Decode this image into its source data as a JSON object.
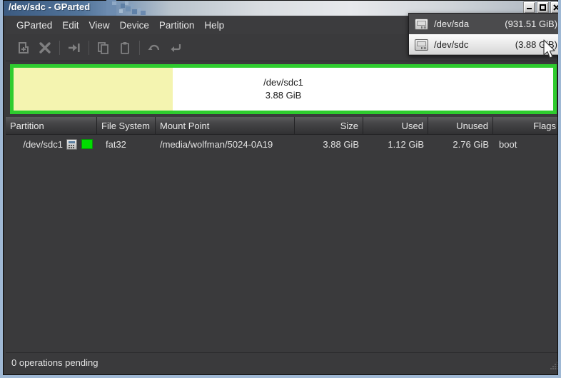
{
  "window": {
    "title": "/dev/sdc - GParted",
    "controls": [
      {
        "name": "minimize",
        "glyph": "–"
      },
      {
        "name": "maximize",
        "glyph": "□"
      },
      {
        "name": "close",
        "glyph": "✕"
      }
    ]
  },
  "menubar": {
    "items": [
      {
        "label": "GParted"
      },
      {
        "label": "Edit"
      },
      {
        "label": "View"
      },
      {
        "label": "Device"
      },
      {
        "label": "Partition"
      },
      {
        "label": "Help"
      }
    ]
  },
  "toolbar": {
    "buttons": [
      {
        "name": "new-partition-icon",
        "label": "New"
      },
      {
        "name": "delete-partition-icon",
        "label": "Delete"
      },
      {
        "name": "resize-move-icon",
        "label": "Resize/Move"
      },
      {
        "name": "copy-icon",
        "label": "Copy"
      },
      {
        "name": "paste-icon",
        "label": "Paste"
      },
      {
        "name": "undo-icon",
        "label": "Undo"
      },
      {
        "name": "apply-icon",
        "label": "Apply"
      }
    ]
  },
  "device_dropdown": {
    "items": [
      {
        "icon": "hard-disk-icon",
        "device": "/dev/sda",
        "size": "(931.51 GiB)",
        "selected": false
      },
      {
        "icon": "hard-disk-icon",
        "device": "/dev/sdc",
        "size": "(3.88 GiB)",
        "selected": true
      }
    ]
  },
  "graphic": {
    "partition_label": "/dev/sdc1",
    "partition_size": "3.88 GiB",
    "border_color": "#2ecc2e",
    "used_color": "#f4f4b0",
    "unused_color": "#ffffff",
    "used_fraction_percent": 29.5
  },
  "table": {
    "columns": [
      {
        "label": "Partition",
        "align": "left"
      },
      {
        "label": "File System",
        "align": "left"
      },
      {
        "label": "Mount Point",
        "align": "left"
      },
      {
        "label": "Size",
        "align": "right"
      },
      {
        "label": "Used",
        "align": "right"
      },
      {
        "label": "Unused",
        "align": "right"
      },
      {
        "label": "Flags",
        "align": "left"
      }
    ],
    "rows": [
      {
        "partition": "/dev/sdc1",
        "filesystem": "fat32",
        "fs_color": "#00dd00",
        "mount_point": "/media/wolfman/5024-0A19",
        "size": "3.88 GiB",
        "used": "1.12 GiB",
        "unused": "2.76 GiB",
        "flags": "boot"
      }
    ]
  },
  "statusbar": {
    "text": "0 operations pending"
  }
}
